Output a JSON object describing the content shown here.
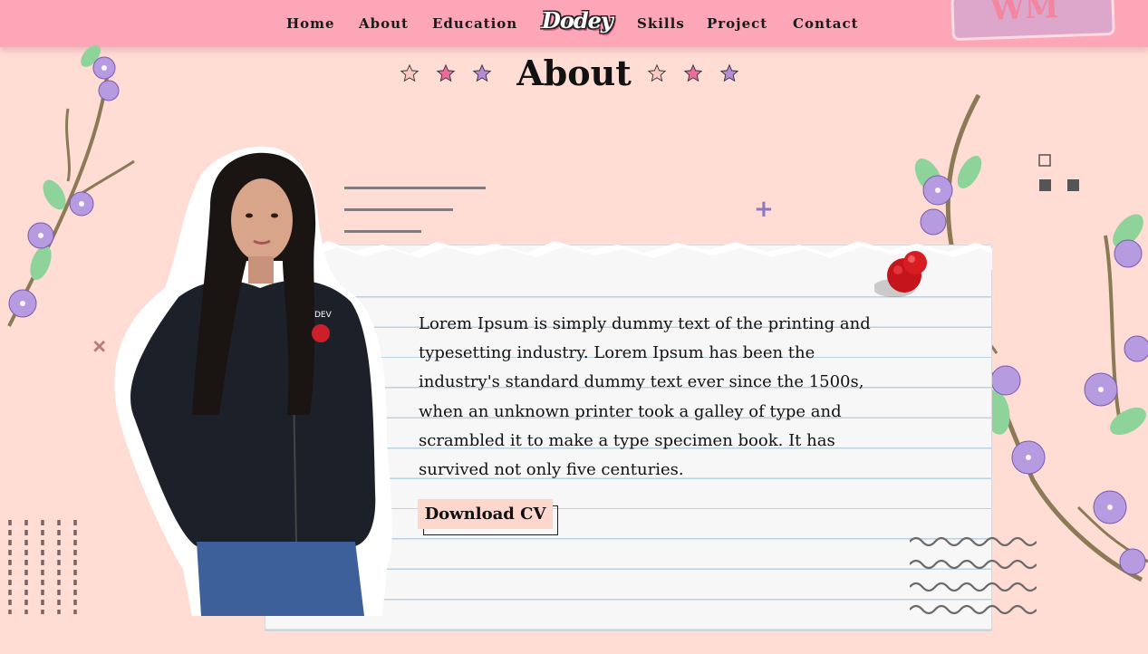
{
  "nav": {
    "items": [
      "Home",
      "About",
      "Education",
      "Skills",
      "Project",
      "Contact"
    ],
    "logo_text": "Dodey"
  },
  "section": {
    "title": "About"
  },
  "about": {
    "paragraph": "Lorem Ipsum is simply dummy text of the printing and typesetting industry. Lorem Ipsum has been the industry's standard dummy text ever since the 1500s, when an unknown printer took a galley of type and scrambled it to make a type specimen book. It has survived not only five centuries.",
    "download_button": "Download CV"
  },
  "colors": {
    "background": "#ffdcd4",
    "navbar": "#fca6b8",
    "star_outline_fill": "#fbc7c0",
    "star_pink": "#ee6b9e",
    "star_purple": "#b68ad6",
    "button_bg": "#fdd7cd"
  },
  "icons": [
    "star-icon",
    "pushpin-icon",
    "plus-icon",
    "flower-branch-icon",
    "wave-icon"
  ]
}
